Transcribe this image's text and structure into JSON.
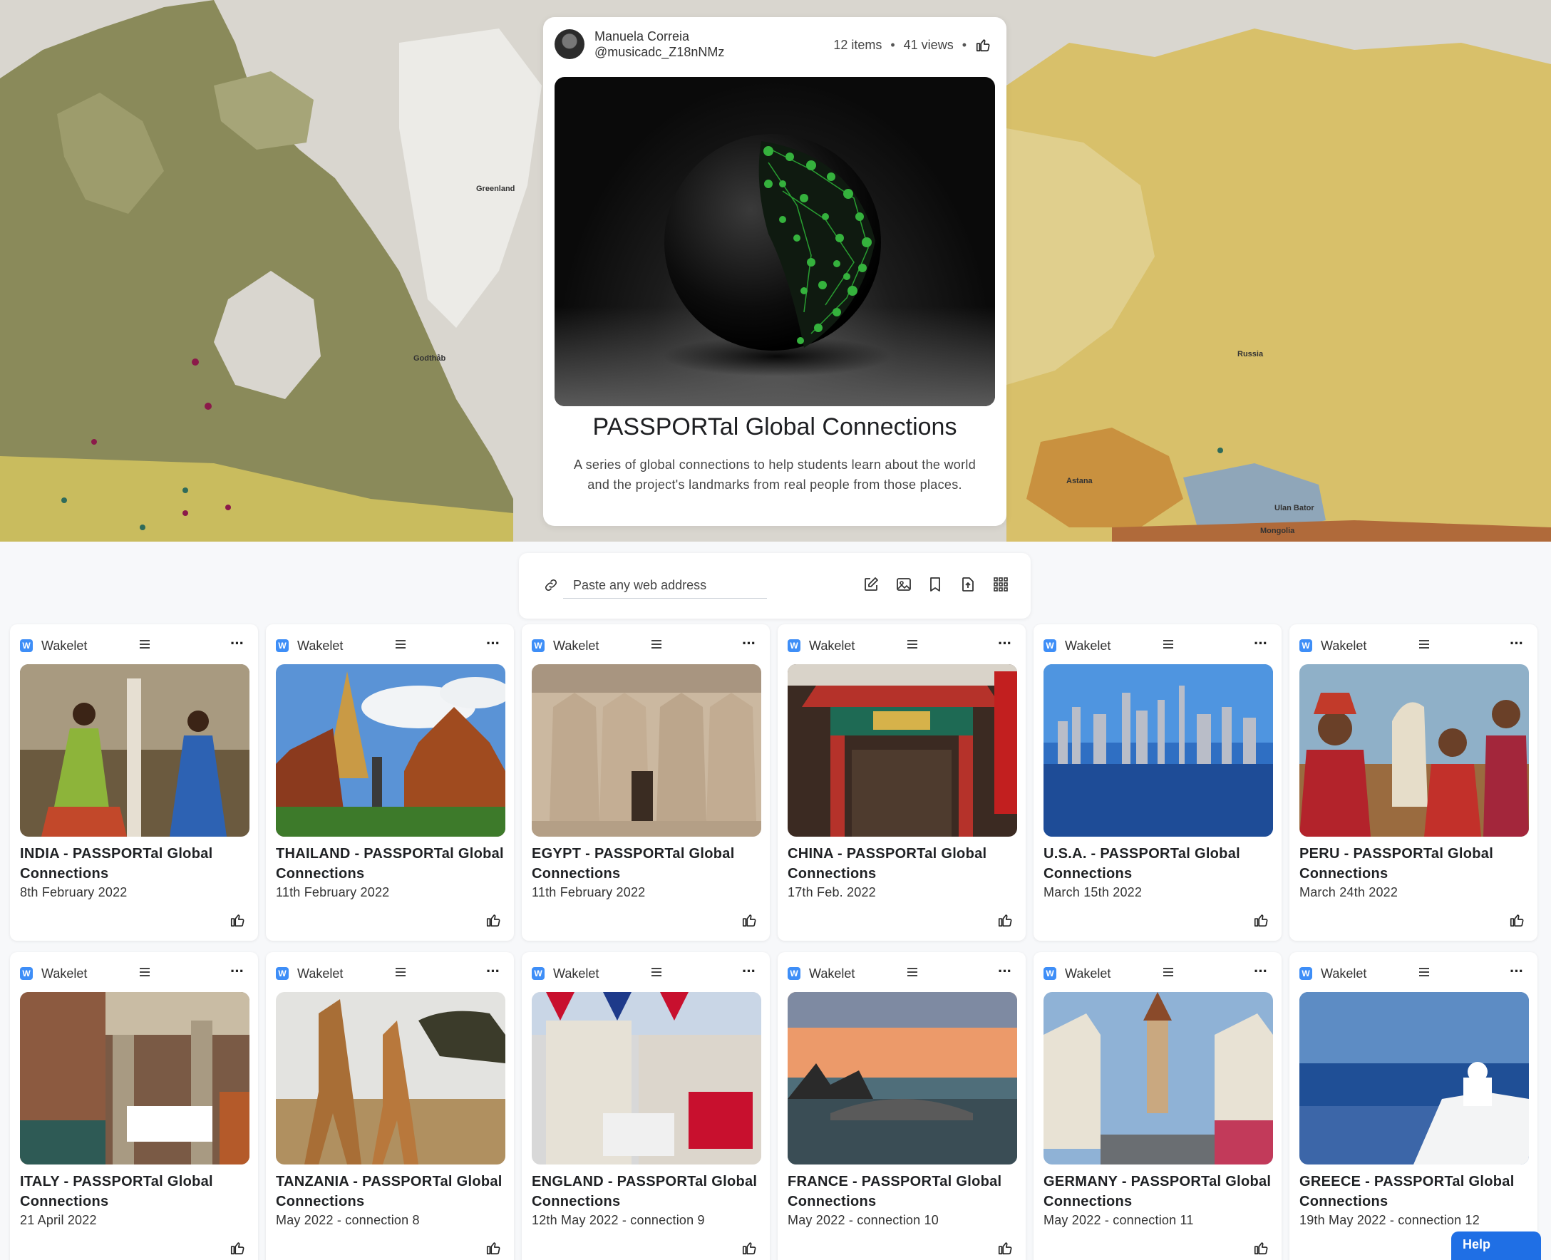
{
  "owner": {
    "name": "Manuela Correia",
    "handle": "@musicadc_Z18nNMz"
  },
  "stats": {
    "items": "12 items",
    "views": "41 views"
  },
  "collection": {
    "title": "PASSPORTal Global Connections",
    "description": "A series of global connections to help students learn about the world and the project's landmarks from real people from those places."
  },
  "addbar": {
    "placeholder": "Paste any web address"
  },
  "map_labels": {
    "greenland": "Greenland",
    "godthab": "Godthåb",
    "russia": "Russia",
    "astana": "Astana",
    "ulan_bator": "Ulan Bator",
    "mongolia": "Mongolia"
  },
  "card_source": "Wakelet",
  "cards": [
    {
      "title": "INDIA - PASSPORTal Global Connections",
      "date": "8th February 2022"
    },
    {
      "title": "THAILAND - PASSPORTal Global Connections",
      "date": "11th February 2022"
    },
    {
      "title": "EGYPT - PASSPORTal Global Connections",
      "date": "11th February 2022"
    },
    {
      "title": "CHINA - PASSPORTal Global Connections",
      "date": "17th Feb. 2022"
    },
    {
      "title": "U.S.A. - PASSPORTal Global Connections",
      "date": "March 15th 2022"
    },
    {
      "title": "PERU - PASSPORTal Global Connections",
      "date": "March 24th 2022"
    },
    {
      "title": "ITALY - PASSPORTal Global Connections",
      "date": "21 April 2022"
    },
    {
      "title": "TANZANIA - PASSPORTal Global Connections",
      "date": "May 2022 - connection 8"
    },
    {
      "title": "ENGLAND - PASSPORTal Global Connections",
      "date": "12th May 2022 - connection 9"
    },
    {
      "title": "FRANCE - PASSPORTal Global Connections",
      "date": "May 2022 - connection 10"
    },
    {
      "title": "GERMANY - PASSPORTal Global Connections",
      "date": "May 2022 - connection 11"
    },
    {
      "title": "GREECE - PASSPORTal Global Connections",
      "date": "19th May 2022 - connection 12"
    }
  ],
  "help": {
    "label": "Help"
  },
  "colors": {
    "accent": "#3e8ef7",
    "help": "#1f6fe5"
  }
}
